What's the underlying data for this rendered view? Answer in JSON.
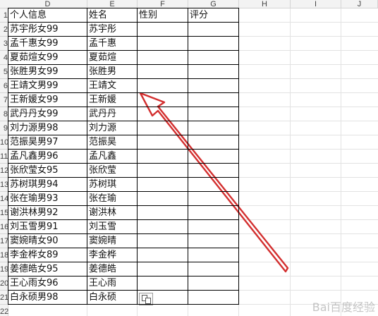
{
  "columns": [
    {
      "letter": "D"
    },
    {
      "letter": "E"
    },
    {
      "letter": "F"
    },
    {
      "letter": "G"
    },
    {
      "letter": "H"
    },
    {
      "letter": "I"
    },
    {
      "letter": "J"
    }
  ],
  "row_numbers": [
    "1",
    "2",
    "3",
    "4",
    "5",
    "6",
    "7",
    "8",
    "9",
    "10",
    "11",
    "12",
    "13",
    "14",
    "15",
    "16",
    "17",
    "18",
    "19",
    "20",
    "21",
    "22"
  ],
  "header_row": {
    "personal_info": "个人信息",
    "name": "姓名",
    "gender": "性别",
    "rating": "评分"
  },
  "rows": [
    {
      "info": "苏宇彤女99",
      "name": "苏宇彤"
    },
    {
      "info": "孟千惠女99",
      "name": "孟千惠"
    },
    {
      "info": "夏茹煊女99",
      "name": "夏茹煊"
    },
    {
      "info": "张胜男女99",
      "name": "张胜男"
    },
    {
      "info": "王靖文男99",
      "name": "王靖文"
    },
    {
      "info": "王新媛女99",
      "name": "王新媛"
    },
    {
      "info": "武丹丹女99",
      "name": "武丹丹"
    },
    {
      "info": "刘力源男98",
      "name": "刘力源"
    },
    {
      "info": "范振昊男97",
      "name": "范振昊"
    },
    {
      "info": "孟凡鑫男96",
      "name": "孟凡鑫"
    },
    {
      "info": "张欣莹女95",
      "name": "张欣莹"
    },
    {
      "info": "苏树琪男94",
      "name": "苏树琪"
    },
    {
      "info": "张在瑜男93",
      "name": "张在瑜"
    },
    {
      "info": "谢洪林男92",
      "name": "谢洪林"
    },
    {
      "info": "刘玉雪男91",
      "name": "刘玉雪"
    },
    {
      "info": "窦婉晴女90",
      "name": "窦婉晴"
    },
    {
      "info": "李金桦女89",
      "name": "李金桦"
    },
    {
      "info": "姜德皓女95",
      "name": "姜德皓"
    },
    {
      "info": "王心雨女96",
      "name": "王心雨"
    },
    {
      "info": "白永硕男98",
      "name": "白永硕"
    }
  ],
  "annotation_color": "#d32f2f",
  "watermark": "Bai百度经验"
}
